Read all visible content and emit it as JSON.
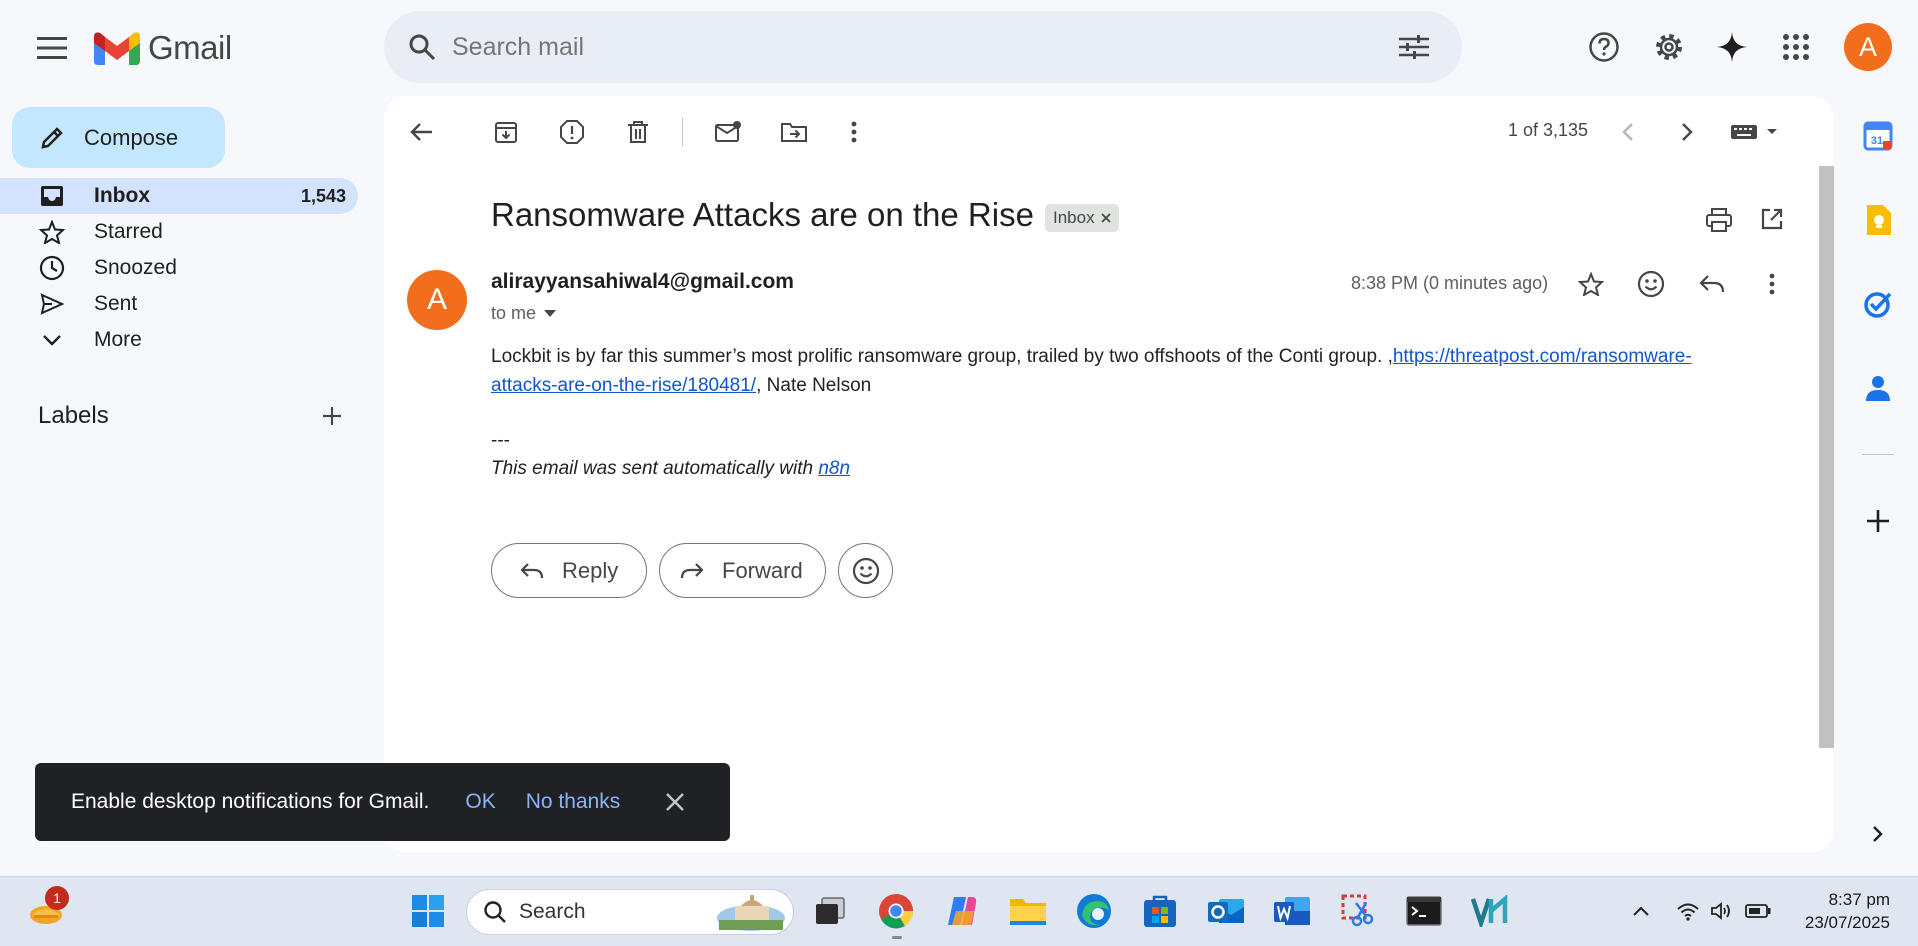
{
  "header": {
    "app_name": "Gmail",
    "search_placeholder": "Search mail",
    "avatar_letter": "A"
  },
  "sidebar": {
    "compose_label": "Compose",
    "items": [
      {
        "label": "Inbox",
        "count": "1,543",
        "icon": "inbox-icon"
      },
      {
        "label": "Starred",
        "count": "",
        "icon": "star-icon"
      },
      {
        "label": "Snoozed",
        "count": "",
        "icon": "clock-icon"
      },
      {
        "label": "Sent",
        "count": "",
        "icon": "send-icon"
      },
      {
        "label": "More",
        "count": "",
        "icon": "chevron-down-icon"
      }
    ],
    "labels_title": "Labels"
  },
  "toolbar": {
    "pager": "1 of 3,135"
  },
  "email": {
    "subject": "Ransomware Attacks are on the Rise",
    "tag": "Inbox",
    "sender_avatar_letter": "A",
    "sender": "alirayyansahiwal4@gmail.com",
    "to": "to me",
    "time": "8:38 PM (0 minutes ago)",
    "body_text": "Lockbit is by far this summer’s most prolific ransomware group, trailed by two offshoots of the Conti group. ,",
    "body_link": "https://threatpost.com/ransomware-attacks-are-on-the-rise/180481/",
    "body_tail": ", Nate Nelson",
    "sig_dash": "---",
    "sig_text": "This email was sent automatically with ",
    "sig_link": "n8n",
    "reply_label": "Reply",
    "forward_label": "Forward"
  },
  "toast": {
    "message": "Enable desktop notifications for Gmail.",
    "ok": "OK",
    "no_thanks": "No thanks"
  },
  "taskbar": {
    "search_label": "Search",
    "notification_count": "1",
    "time": "8:37 pm",
    "date": "23/07/2025"
  },
  "colors": {
    "accent": "#0b57d0",
    "compose_bg": "#c2e7ff",
    "inbox_active_bg": "#d3e3fd",
    "avatar": "#f26e1c"
  }
}
